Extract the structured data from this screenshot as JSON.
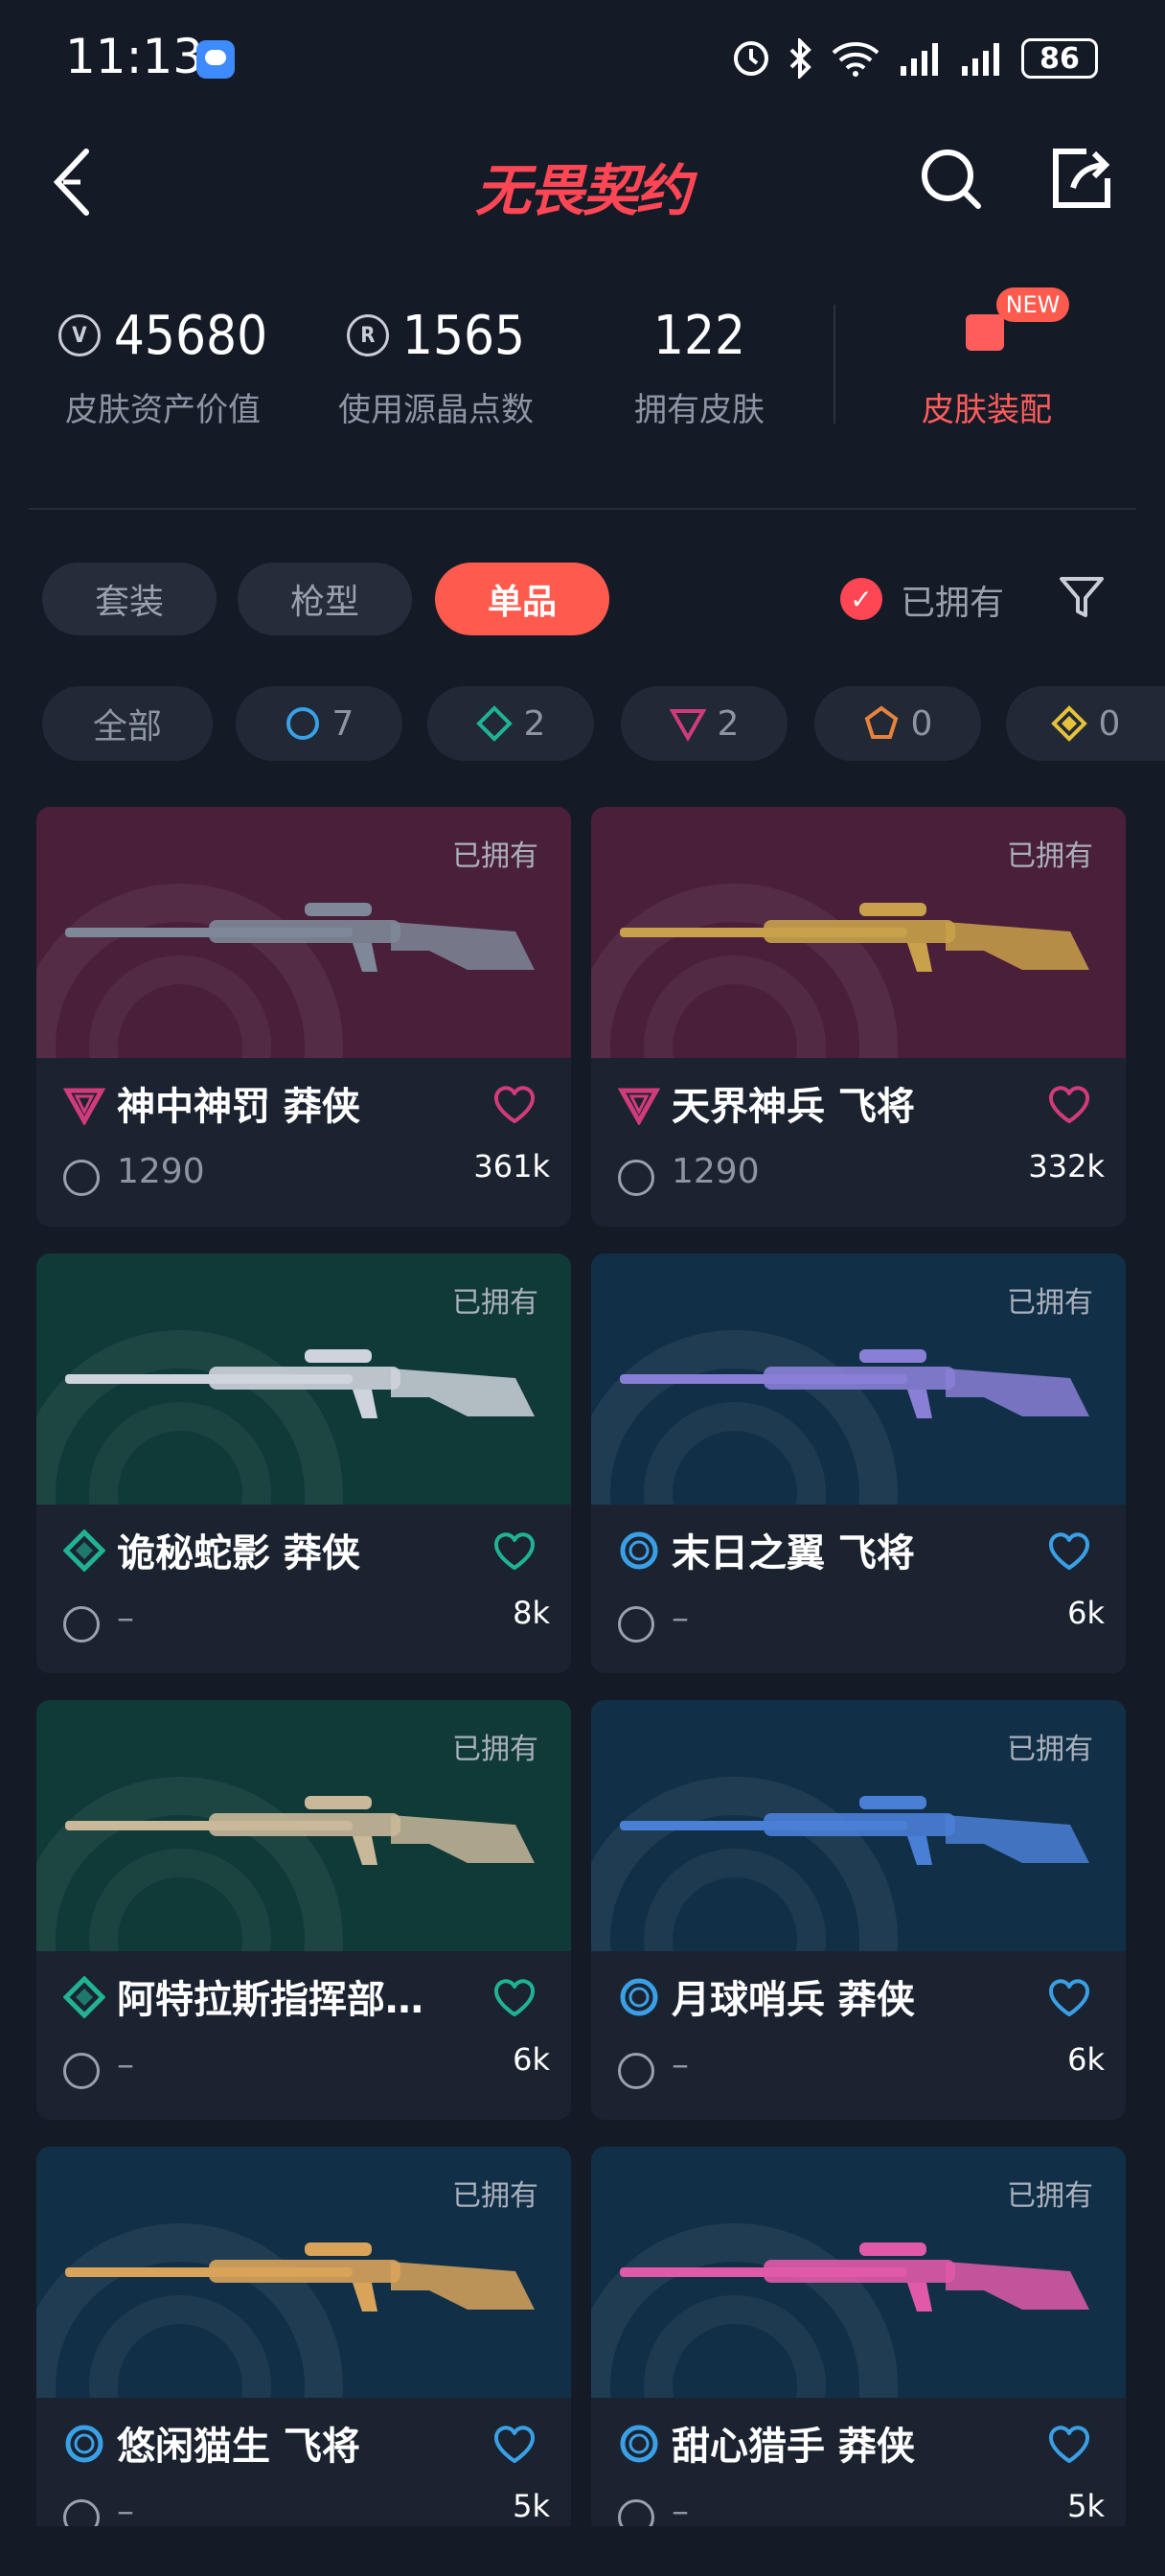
{
  "status_bar": {
    "time": "11:13",
    "battery": "86"
  },
  "header": {
    "title": "无畏契约"
  },
  "stats": [
    {
      "value": "45680",
      "label": "皮肤资产价值",
      "icon": "vp-coin-icon"
    },
    {
      "value": "1565",
      "label": "使用源晶点数",
      "icon": "radianite-icon"
    },
    {
      "value": "122",
      "label": "拥有皮肤"
    }
  ],
  "equip": {
    "label": "皮肤装配",
    "badge": "NEW"
  },
  "tabs": [
    {
      "label": "套装",
      "active": false
    },
    {
      "label": "枪型",
      "active": false
    },
    {
      "label": "单品",
      "active": true
    }
  ],
  "owned_filter": {
    "label": "已拥有",
    "checked": true
  },
  "rarity_chips": [
    {
      "label": "全部"
    },
    {
      "count": "7",
      "tier": "select",
      "color": "#3aa0e6"
    },
    {
      "count": "2",
      "tier": "deluxe",
      "color": "#1fb394"
    },
    {
      "count": "2",
      "tier": "premium",
      "color": "#d13b7a"
    },
    {
      "count": "0",
      "tier": "exclusive",
      "color": "#e8823b"
    },
    {
      "count": "0",
      "tier": "ultra",
      "color": "#e6c13b"
    }
  ],
  "cards": [
    {
      "owned": "已拥有",
      "name": "神中神罚 莽侠",
      "price": "1290",
      "likes": "361k",
      "tier": "premium",
      "color": "#d13b7a",
      "bg": "bg-purple"
    },
    {
      "owned": "已拥有",
      "name": "天界神兵 飞将",
      "price": "1290",
      "likes": "332k",
      "tier": "premium",
      "color": "#d13b7a",
      "bg": "bg-purple"
    },
    {
      "owned": "已拥有",
      "name": "诡秘蛇影 莽侠",
      "price": "–",
      "likes": "8k",
      "tier": "deluxe",
      "color": "#1fb394",
      "bg": "bg-green"
    },
    {
      "owned": "已拥有",
      "name": "末日之翼 飞将",
      "price": "–",
      "likes": "6k",
      "tier": "select",
      "color": "#3aa0e6",
      "bg": "bg-blue"
    },
    {
      "owned": "已拥有",
      "name": "阿特拉斯指挥部…",
      "price": "–",
      "likes": "6k",
      "tier": "deluxe",
      "color": "#1fb394",
      "bg": "bg-green"
    },
    {
      "owned": "已拥有",
      "name": "月球哨兵 莽侠",
      "price": "–",
      "likes": "6k",
      "tier": "select",
      "color": "#3aa0e6",
      "bg": "bg-blue"
    },
    {
      "owned": "已拥有",
      "name": "悠闲猫生 飞将",
      "price": "–",
      "likes": "5k",
      "tier": "select",
      "color": "#3aa0e6",
      "bg": "bg-blue"
    },
    {
      "owned": "已拥有",
      "name": "甜心猎手 莽侠",
      "price": "–",
      "likes": "5k",
      "tier": "select",
      "color": "#3aa0e6",
      "bg": "bg-blue"
    }
  ]
}
